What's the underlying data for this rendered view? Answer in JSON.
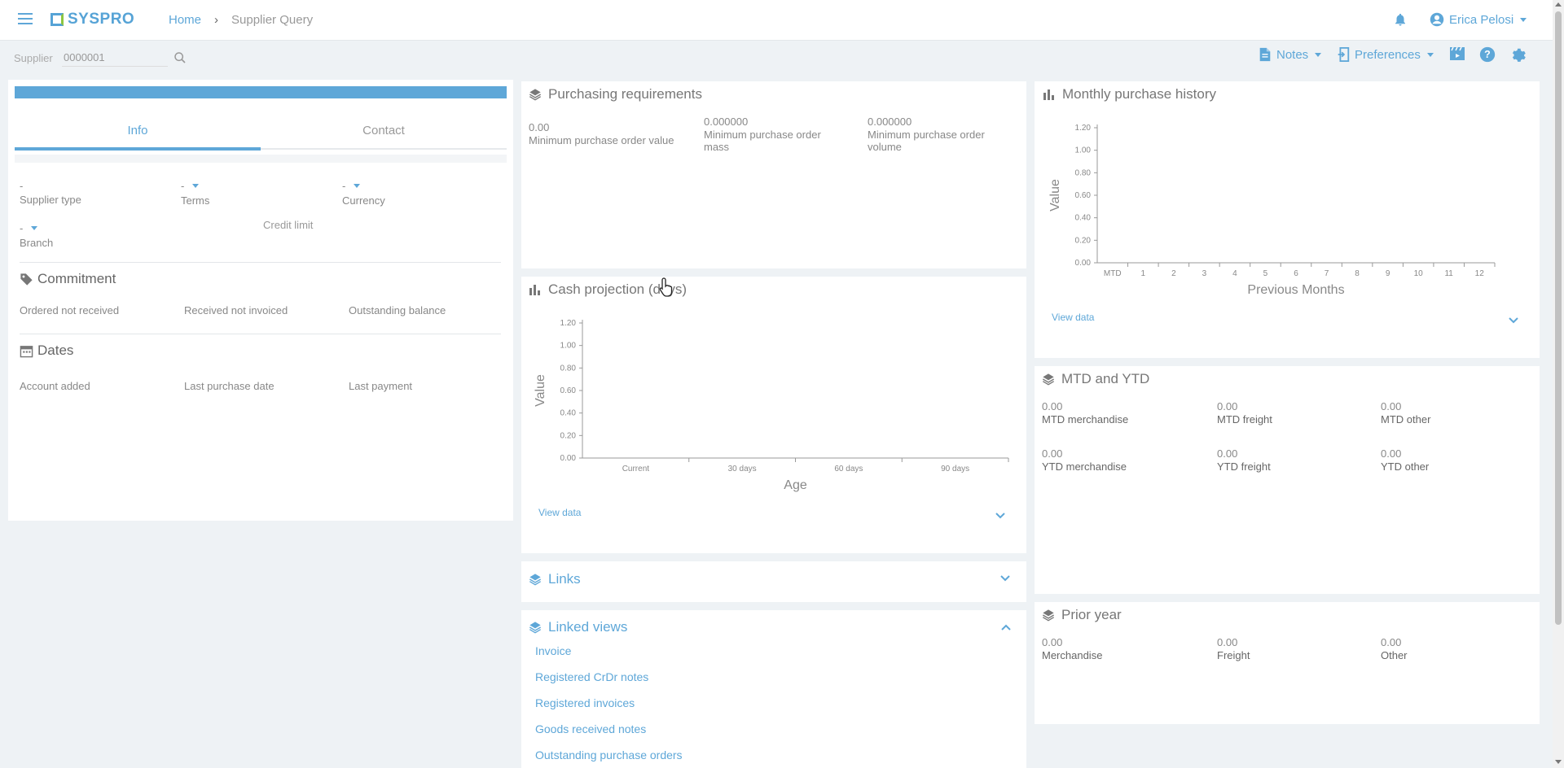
{
  "header": {
    "logo_text": "SYSPRO",
    "breadcrumb_home": "Home",
    "breadcrumb_current": "Supplier Query",
    "user_name": "Erica Pelosi"
  },
  "toolbar": {
    "supplier_label": "Supplier",
    "supplier_value": "0000001",
    "notes_label": "Notes",
    "preferences_label": "Preferences"
  },
  "left_panel": {
    "tabs": [
      {
        "label": "Info"
      },
      {
        "label": "Contact"
      }
    ],
    "fields": {
      "supplier_type": {
        "value": "-",
        "label": "Supplier type"
      },
      "terms": {
        "value": "-",
        "label": "Terms"
      },
      "currency": {
        "value": "-",
        "label": "Currency"
      },
      "branch": {
        "value": "-",
        "label": "Branch"
      },
      "credit_limit": {
        "label": "Credit limit"
      }
    },
    "commitment": {
      "title": "Commitment",
      "labels": [
        "Ordered not received",
        "Received not invoiced",
        "Outstanding balance"
      ]
    },
    "dates": {
      "title": "Dates",
      "labels": [
        "Account added",
        "Last purchase date",
        "Last payment"
      ]
    }
  },
  "purchasing": {
    "title": "Purchasing requirements",
    "items": [
      {
        "value": "0.00",
        "label": "Minimum purchase order value"
      },
      {
        "value": "0.000000",
        "label_line1": "Minimum purchase order",
        "label_line2": "mass"
      },
      {
        "value": "0.000000",
        "label_line1": "Minimum purchase order",
        "label_line2": "volume"
      }
    ]
  },
  "cash_projection": {
    "title": "Cash projection (days)",
    "view_data": "View data"
  },
  "monthly_history": {
    "title": "Monthly purchase history",
    "view_data": "View data"
  },
  "chart_data": [
    {
      "type": "bar",
      "title": "Cash projection (days)",
      "xlabel": "Age",
      "ylabel": "Value",
      "categories": [
        "Current",
        "30 days",
        "60 days",
        "90 days"
      ],
      "values": [
        0,
        0,
        0,
        0
      ],
      "ylim": [
        0,
        1.2
      ],
      "yticks": [
        "0.00",
        "0.20",
        "0.40",
        "0.60",
        "0.80",
        "1.00",
        "1.20"
      ]
    },
    {
      "type": "bar",
      "title": "Monthly purchase history",
      "xlabel": "Previous Months",
      "ylabel": "Value",
      "categories": [
        "MTD",
        "1",
        "2",
        "3",
        "4",
        "5",
        "6",
        "7",
        "8",
        "9",
        "10",
        "11",
        "12"
      ],
      "values": [
        0,
        0,
        0,
        0,
        0,
        0,
        0,
        0,
        0,
        0,
        0,
        0,
        0
      ],
      "ylim": [
        0,
        1.2
      ],
      "yticks": [
        "0.00",
        "0.20",
        "0.40",
        "0.60",
        "0.80",
        "1.00",
        "1.20"
      ]
    }
  ],
  "links": {
    "title": "Links"
  },
  "linked_views": {
    "title": "Linked views",
    "items": [
      "Invoice",
      "Registered CrDr notes",
      "Registered invoices",
      "Goods received notes",
      "Outstanding purchase orders"
    ]
  },
  "mtd_ytd": {
    "title": "MTD and YTD",
    "items": [
      {
        "value": "0.00",
        "label": "MTD merchandise"
      },
      {
        "value": "0.00",
        "label": "MTD freight"
      },
      {
        "value": "0.00",
        "label": "MTD other"
      },
      {
        "value": "0.00",
        "label": "YTD merchandise"
      },
      {
        "value": "0.00",
        "label": "YTD freight"
      },
      {
        "value": "0.00",
        "label": "YTD other"
      }
    ]
  },
  "prior_year": {
    "title": "Prior year",
    "items": [
      {
        "value": "0.00",
        "label": "Merchandise"
      },
      {
        "value": "0.00",
        "label": "Freight"
      },
      {
        "value": "0.00",
        "label": "Other"
      }
    ]
  },
  "colors": {
    "accent": "#5ea7d8",
    "panel_bg": "#ffffff",
    "page_bg": "#eef2f5"
  }
}
